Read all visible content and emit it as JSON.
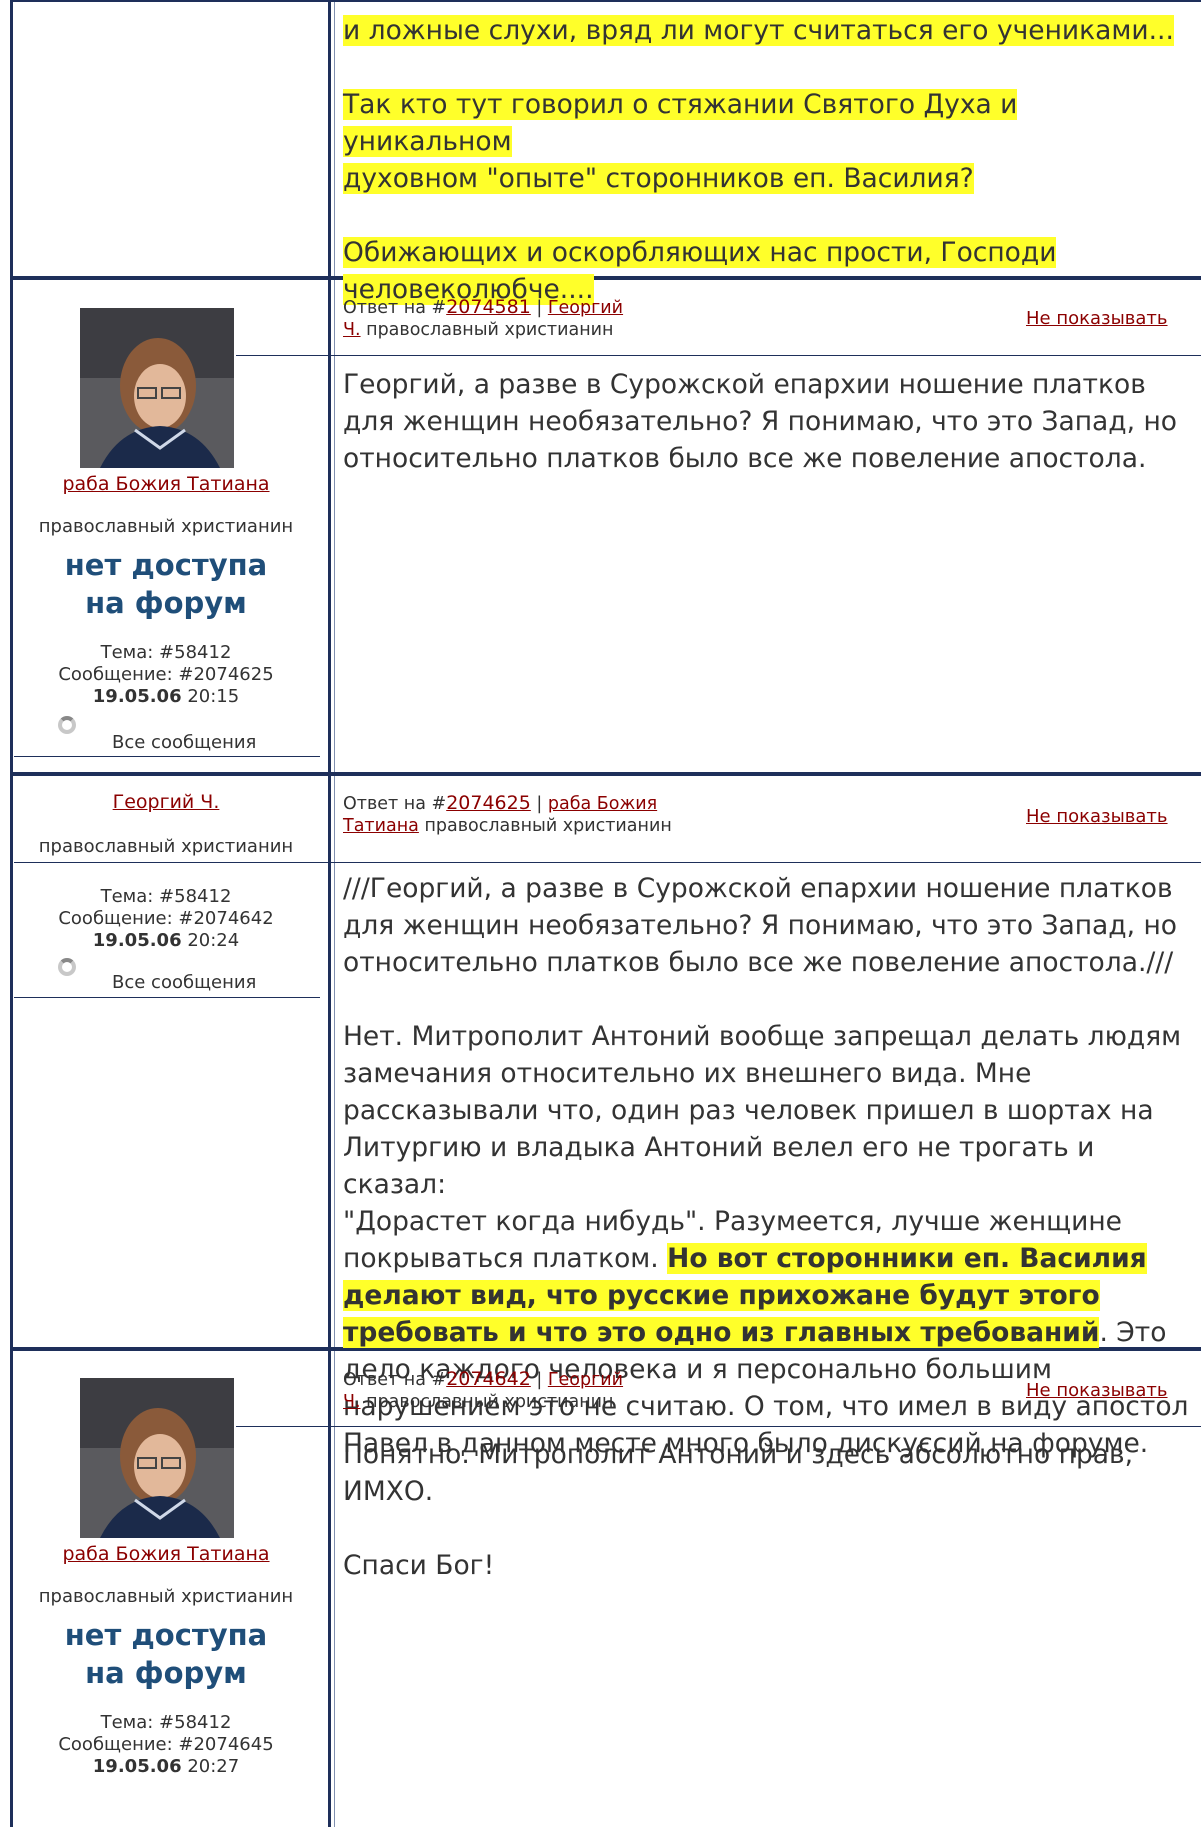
{
  "post0": {
    "lines": [
      "и ложные слухи, вряд ли могут считаться его учениками...",
      "Так кто тут говорил о стяжании Святого Духа и уникальном",
      "духовном \"опыте\" сторонников еп. Василия?",
      "Обижающих и оскорбляющих нас прости, Господи",
      "человеколюбче...."
    ]
  },
  "post1": {
    "reply_prefix": "Ответ на #",
    "reply_id": "2074581",
    "reply_sep": " | ",
    "reply_author_1": "Георгий",
    "reply_author_2": "Ч.",
    "reply_status": " православный христианин",
    "hide_label": "Не показывать",
    "author": "раба Божия Татиана",
    "author_status": "православный христианин",
    "no_access_1": "нет доступа",
    "no_access_2": "на форум",
    "topic": "Тема: #58412",
    "message": "Сообщение: #2074625",
    "date": "19.05.06",
    "time": " 20:15",
    "all_messages": "Все сообщения",
    "lines": [
      "Георгий, а разве в Сурожской епархии ношение платков",
      "для женщин необязательно? Я понимаю, что это Запад, но",
      "относительно платков было все же повеление апостола."
    ]
  },
  "post2": {
    "reply_prefix": "Ответ на #",
    "reply_id": "2074625",
    "reply_sep": " | ",
    "reply_author_1": "раба Божия",
    "reply_author_2": "Татиана",
    "reply_status": " православный христианин",
    "hide_label": "Не показывать",
    "author": "Георгий Ч.",
    "author_status": "православный христианин",
    "topic": "Тема: #58412",
    "message": "Сообщение: #2074642",
    "date": "19.05.06",
    "time": " 20:24",
    "all_messages": "Все сообщения",
    "lines": [
      "///Георгий, а разве в Сурожской епархии ношение платков",
      "для женщин необязательно? Я понимаю, что это Запад, но",
      "относительно платков было все же повеление апостола.///",
      "Нет. Митрополит Антоний вообще запрещал делать людям",
      "замечания относительно их внешнего вида. Мне",
      "рассказывали что, один раз человек пришел в шортах на",
      "Литургию и владыка Антоний велел его не трогать и сказал:",
      "\"Дорастет когда нибудь\". Разумеется, лучше женщине",
      "покрываться платком. ",
      "Но вот сторонники еп. Василия",
      "делают вид, что русские прихожане будут этого",
      "требовать и что это одно из главных требований",
      ". Это",
      "дело каждого человека и я персонально большим",
      "нарушением это не считаю. О том, что имел в виду апостол",
      "Павел в данном месте много было дискуссий на форуме."
    ]
  },
  "post3": {
    "reply_prefix": "Ответ на #",
    "reply_id": "2074642",
    "reply_sep": " | ",
    "reply_author_1": "Георгий",
    "reply_author_2": "Ч.",
    "reply_status": " православный христианин",
    "hide_label": "Не показывать",
    "author": "раба Божия Татиана",
    "author_status": "православный христианин",
    "no_access_1": "нет доступа",
    "no_access_2": "на форум",
    "topic": "Тема: #58412",
    "message": "Сообщение: #2074645",
    "date": "19.05.06",
    "time": " 20:27",
    "lines": [
      "Понятно. Митрополит Антоний и здесь абсолютно прав,",
      "ИМХО.",
      "Спаси Бог!"
    ]
  }
}
